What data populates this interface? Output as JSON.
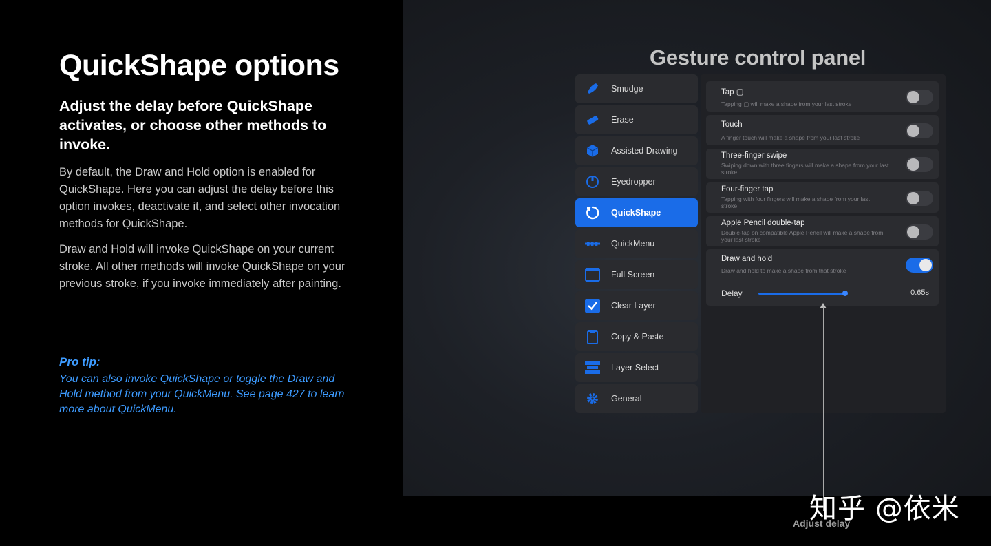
{
  "left": {
    "title": "QuickShape options",
    "subtitle": "Adjust the delay before QuickShape activates, or choose other methods to invoke.",
    "paragraph1": "By default, the Draw and Hold option is enabled for QuickShape. Here you can adjust the delay before this option invokes, deactivate it, and select other invocation methods for QuickShape.",
    "paragraph2": "Draw and Hold will invoke QuickShape on your current stroke. All other methods will invoke QuickShape on your previous stroke, if you invoke immediately after painting.",
    "protip_title": "Pro tip:",
    "protip_body": "You can also invoke QuickShape or toggle the Draw and Hold method from your QuickMenu. See page 427 to learn more about QuickMenu."
  },
  "panel": {
    "title": "Gesture control panel",
    "accent": "#1a6ce8",
    "menu": [
      {
        "label": "Smudge",
        "icon": "smudge-icon"
      },
      {
        "label": "Erase",
        "icon": "erase-icon"
      },
      {
        "label": "Assisted Drawing",
        "icon": "assisted-drawing-icon"
      },
      {
        "label": "Eyedropper",
        "icon": "eyedropper-icon"
      },
      {
        "label": "QuickShape",
        "icon": "quickshape-icon",
        "active": true
      },
      {
        "label": "QuickMenu",
        "icon": "quickmenu-icon"
      },
      {
        "label": "Full Screen",
        "icon": "full-screen-icon"
      },
      {
        "label": "Clear Layer",
        "icon": "clear-layer-icon"
      },
      {
        "label": "Copy & Paste",
        "icon": "copy-paste-icon"
      },
      {
        "label": "Layer Select",
        "icon": "layer-select-icon"
      },
      {
        "label": "General",
        "icon": "gear-icon"
      }
    ],
    "options": [
      {
        "title": "Tap ▢",
        "desc": "Tapping ▢ will make a shape from your last stroke",
        "on": false
      },
      {
        "title": "Touch",
        "desc": "A finger touch will make a shape from your last stroke",
        "on": false
      },
      {
        "title": "Three-finger swipe",
        "desc": "Swiping down with three fingers will make a shape from your last stroke",
        "on": false
      },
      {
        "title": "Four-finger tap",
        "desc": "Tapping with four fingers will make a shape from your last stroke",
        "on": false
      },
      {
        "title": "Apple Pencil double-tap",
        "desc": "Double-tap on compatible Apple Pencil will make a shape from your last stroke",
        "on": false
      }
    ],
    "draw_and_hold": {
      "title": "Draw and hold",
      "desc": "Draw and hold to make a shape from that stroke",
      "on": true,
      "delay_label": "Delay",
      "delay_value": "0.65s"
    }
  },
  "callout": "Adjust delay",
  "watermark": "知乎 @依米"
}
